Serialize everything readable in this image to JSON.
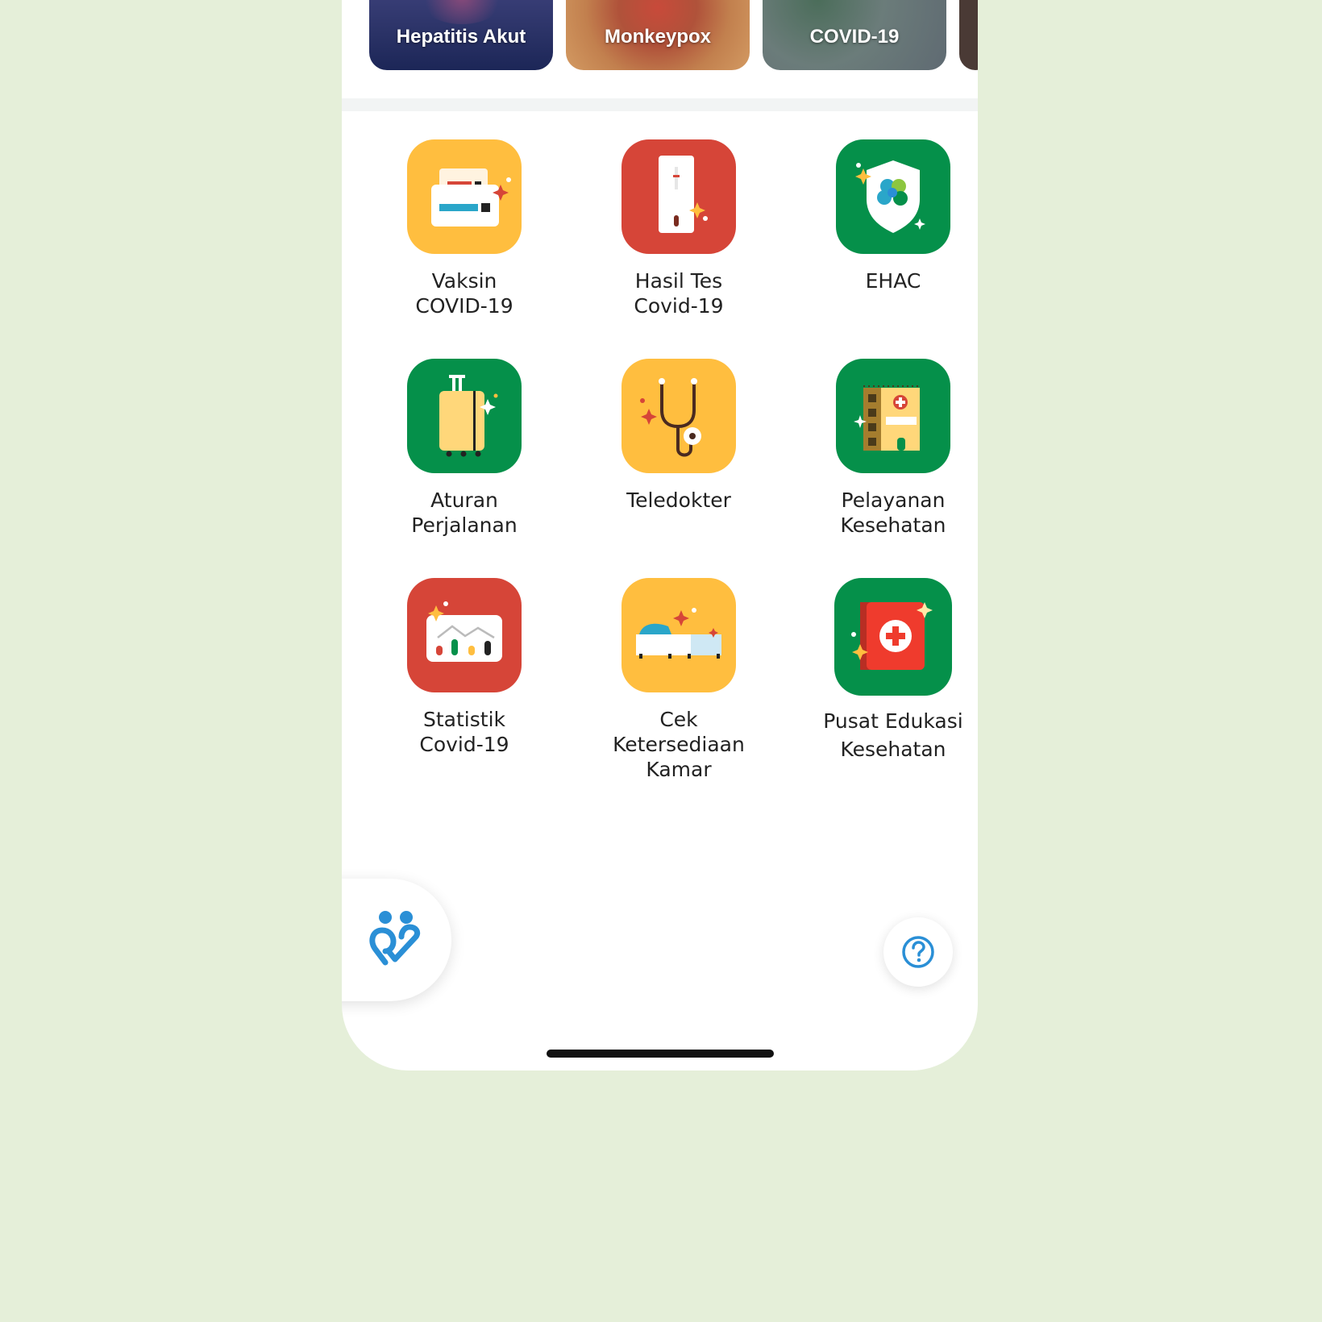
{
  "topics": [
    {
      "label": "Hepatitis Akut"
    },
    {
      "label": "Monkeypox"
    },
    {
      "label": "COVID-19"
    }
  ],
  "menu": [
    {
      "label": "Vaksin\nCOVID-19",
      "icon": "vaccine-card-icon",
      "color": "#ffbe3f"
    },
    {
      "label": "Hasil Tes\nCovid-19",
      "icon": "test-kit-icon",
      "color": "#d64538"
    },
    {
      "label": "EHAC",
      "icon": "shield-icon",
      "color": "#05904a"
    },
    {
      "label": "Aturan\nPerjalanan",
      "icon": "suitcase-icon",
      "color": "#05904a"
    },
    {
      "label": "Teledokter",
      "icon": "stethoscope-icon",
      "color": "#ffbe3f"
    },
    {
      "label": "Pelayanan\nKesehatan",
      "icon": "hospital-icon",
      "color": "#05904a"
    },
    {
      "label": "Statistik\nCovid-19",
      "icon": "chart-icon",
      "color": "#d64538"
    },
    {
      "label": "Cek\nKetersediaan\nKamar",
      "icon": "bed-icon",
      "color": "#ffbe3f"
    },
    {
      "label": "Pusat Edukasi\nKesehatan",
      "icon": "health-book-icon",
      "color": "#05904a"
    }
  ],
  "colors": {
    "accent": "#2a8fd6",
    "background": "#e5efd9"
  }
}
